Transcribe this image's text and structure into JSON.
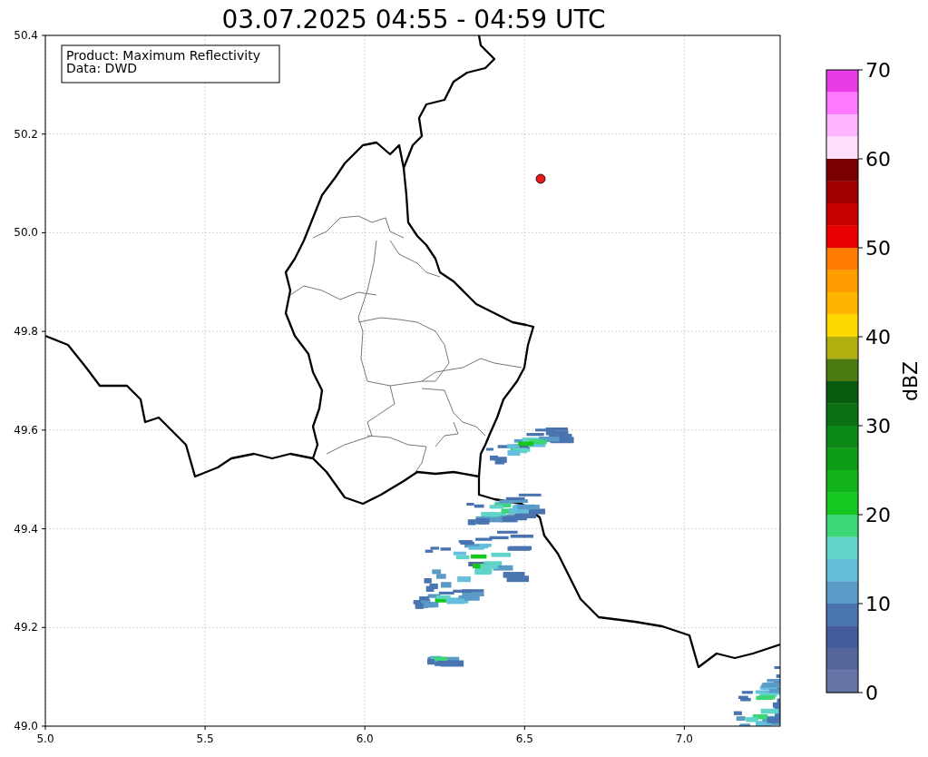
{
  "title": "03.07.2025 04:55 - 04:59 UTC",
  "info_box": [
    "Product: Maximum Reflectivity",
    "Data: DWD"
  ],
  "map": {
    "x_ticks": [
      "5.0",
      "5.5",
      "6.0",
      "6.5",
      "7.0"
    ],
    "y_ticks": [
      "50.4",
      "50.2",
      "50.0",
      "49.8",
      "49.6",
      "49.4",
      "49.2",
      "49.0"
    ]
  },
  "colorbar": {
    "label": "dBZ",
    "ticks": [
      "70",
      "60",
      "50",
      "40",
      "30",
      "20",
      "10",
      "0"
    ],
    "segments": [
      {
        "color": "#e83ce8"
      },
      {
        "color": "#ff78ff"
      },
      {
        "color": "#ffb4ff"
      },
      {
        "color": "#ffe0ff"
      },
      {
        "color": "#780000"
      },
      {
        "color": "#a00000"
      },
      {
        "color": "#c40000"
      },
      {
        "color": "#e80000"
      },
      {
        "color": "#ff7c00"
      },
      {
        "color": "#ff9c00"
      },
      {
        "color": "#ffb400"
      },
      {
        "color": "#ffd800"
      },
      {
        "color": "#b0b010"
      },
      {
        "color": "#4a7a10"
      },
      {
        "color": "#085a0e"
      },
      {
        "color": "#0a7012"
      },
      {
        "color": "#0c8816"
      },
      {
        "color": "#0e9c16"
      },
      {
        "color": "#12b41a"
      },
      {
        "color": "#14c820"
      },
      {
        "color": "#3cd676"
      },
      {
        "color": "#60d4c8"
      },
      {
        "color": "#64bedc"
      },
      {
        "color": "#5a9ac6"
      },
      {
        "color": "#4a74b0"
      },
      {
        "color": "#445c9c"
      },
      {
        "color": "#55669d"
      },
      {
        "color": "#6673a6"
      }
    ]
  }
}
